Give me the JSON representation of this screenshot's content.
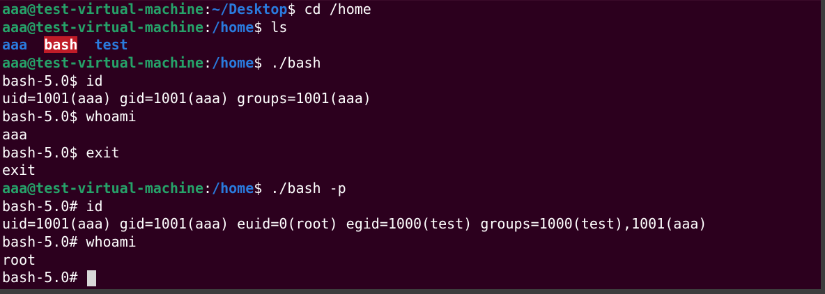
{
  "colors": {
    "background": "#2c001e",
    "prompt_user": "#26a269",
    "prompt_path": "#2a7bde",
    "text": "#ffffff",
    "exec_highlight": "#c01c28",
    "cursor": "#d8d8d8"
  },
  "lines": [
    {
      "user": "aaa@test-virtual-machine",
      "sep": ":",
      "path": "~/Desktop",
      "dollar": "$ ",
      "cmd": "cd /home"
    },
    {
      "user": "aaa@test-virtual-machine",
      "sep": ":",
      "path": "/home",
      "dollar": "$ ",
      "cmd": "ls"
    },
    {
      "ls_1": "aaa",
      "ls_gap1": "  ",
      "ls_2": "bash",
      "ls_gap2": "  ",
      "ls_3": "test"
    },
    {
      "user": "aaa@test-virtual-machine",
      "sep": ":",
      "path": "/home",
      "dollar": "$ ",
      "cmd": "./bash"
    },
    {
      "text": "bash-5.0$ id"
    },
    {
      "text": "uid=1001(aaa) gid=1001(aaa) groups=1001(aaa)"
    },
    {
      "text": "bash-5.0$ whoami"
    },
    {
      "text": "aaa"
    },
    {
      "text": "bash-5.0$ exit"
    },
    {
      "text": "exit"
    },
    {
      "user": "aaa@test-virtual-machine",
      "sep": ":",
      "path": "/home",
      "dollar": "$ ",
      "cmd": "./bash -p"
    },
    {
      "text": "bash-5.0# id"
    },
    {
      "text": "uid=1001(aaa) gid=1001(aaa) euid=0(root) egid=1000(test) groups=1000(test),1001(aaa)"
    },
    {
      "text": "bash-5.0# whoami"
    },
    {
      "text": "root"
    },
    {
      "prompt": "bash-5.0# "
    }
  ],
  "cursor_icon": "block-cursor"
}
